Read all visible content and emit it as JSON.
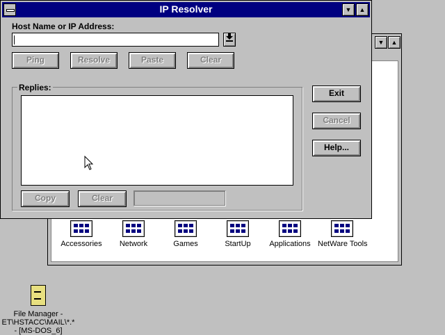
{
  "desktop": {
    "program_groups": [
      {
        "label": "Accessories"
      },
      {
        "label": "Network"
      },
      {
        "label": "Games"
      },
      {
        "label": "StartUp"
      },
      {
        "label": "Applications"
      },
      {
        "label": "NetWare Tools"
      }
    ],
    "file_manager": {
      "line1": "File Manager -",
      "line2": "ET\\HSTACC\\MAIL\\*.*",
      "line3": "- [MS-DOS_6]"
    }
  },
  "dialog": {
    "title": "IP Resolver",
    "host_label": "Host Name or IP Address:",
    "host_value": "",
    "buttons_row": [
      {
        "label": "Ping",
        "enabled": false
      },
      {
        "label": "Resolve",
        "enabled": false
      },
      {
        "label": "Paste",
        "enabled": false
      },
      {
        "label": "Clear",
        "enabled": false
      }
    ],
    "replies_label": "Replies:",
    "replies_text": "",
    "reply_buttons": [
      {
        "label": "Copy",
        "enabled": false
      },
      {
        "label": "Clear",
        "enabled": false
      }
    ],
    "side_buttons": [
      {
        "label": "Exit",
        "enabled": true
      },
      {
        "label": "Cancel",
        "enabled": false
      },
      {
        "label": "Help...",
        "enabled": true
      }
    ]
  },
  "icons": {
    "combo_arrow": "arrow-down-bar-icon",
    "minimize": "triangle-down-icon",
    "maximize": "triangle-up-icon"
  },
  "colors": {
    "titlebar": "#000080",
    "face": "#c0c0c0",
    "disabled_text": "#808080"
  }
}
